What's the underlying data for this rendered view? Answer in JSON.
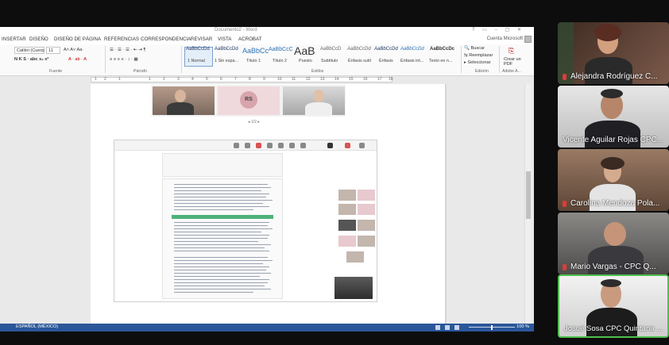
{
  "word": {
    "title": "Documento2 - Word",
    "account": "Cuenta Microsoft",
    "tabs": [
      "INSERTAR",
      "DISEÑO",
      "DISEÑO DE PÁGINA",
      "REFERENCIAS",
      "CORRESPONDENCIA",
      "REVISAR",
      "VISTA",
      "ACROBAT"
    ],
    "font": {
      "name": "Calibri (Cuerp",
      "size": "11"
    },
    "styles": [
      {
        "sample": "AaBbCcDd",
        "name": "1 Normal"
      },
      {
        "sample": "AaBbCcDd",
        "name": "1 Sin espa..."
      },
      {
        "sample": "AaBbCc",
        "name": "Título 1"
      },
      {
        "sample": "AaBbCcC",
        "name": "Título 2"
      },
      {
        "sample": "AaB",
        "name": "Puesto"
      },
      {
        "sample": "AaBbCcD",
        "name": "Subtítulo"
      },
      {
        "sample": "AaBbCcDd",
        "name": "Énfasis sutil"
      },
      {
        "sample": "AaBbCcDd",
        "name": "Énfasis"
      },
      {
        "sample": "AaBbCcDd",
        "name": "Énfasis int..."
      },
      {
        "sample": "AaBbCcDc",
        "name": "Texto en n..."
      }
    ],
    "groups": {
      "font": "Fuente",
      "paragraph": "Párrafo",
      "styles": "Estilos",
      "edit": "Edición",
      "adobe": "Adobe A..."
    },
    "edit": {
      "find": "Buscar",
      "replace": "Reemplazar",
      "select": "Seleccionar"
    },
    "pdf": "Crear un PDF",
    "ruler": [
      "1",
      "2",
      "1",
      "1",
      "2",
      "3",
      "4",
      "5",
      "6",
      "7",
      "8",
      "9",
      "10",
      "11",
      "12",
      "13",
      "14",
      "15",
      "16",
      "17",
      "18"
    ],
    "doc": {
      "rs_initials": "RS",
      "pager": "◂ 1/2 ▸"
    },
    "status": {
      "language": "ESPAÑOL (MÉXICO)",
      "zoom": "100 %"
    }
  },
  "participants": [
    {
      "name": "Alejandra Rodríguez C...",
      "muted": true,
      "bg": "#6b4a3d"
    },
    {
      "name": "Vicente Aguilar Rojas CPC...",
      "muted": false,
      "bg": "#cfcfcf"
    },
    {
      "name": "Carolina Mendoza Pola...",
      "muted": true,
      "bg": "#8c6b58"
    },
    {
      "name": "Mario Vargas - CPC Q...",
      "muted": true,
      "bg": "#6d6b6a"
    },
    {
      "name": "Josué Sosa CPC Quintana ...",
      "muted": false,
      "bg": "#d9d9d9",
      "active": true
    }
  ],
  "colors": {
    "accent": "#2b579a",
    "active_speaker": "#4fbf4f",
    "mic_muted": "#e03a3a"
  }
}
